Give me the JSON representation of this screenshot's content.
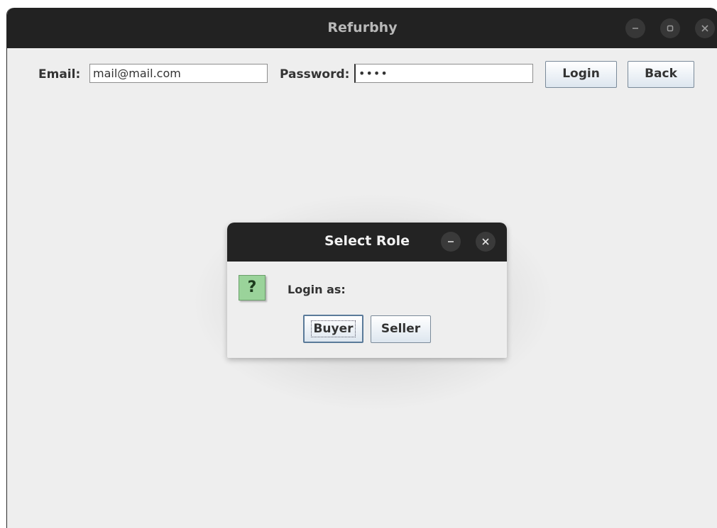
{
  "window": {
    "title": "Refurbhy",
    "minimize_symbol": "–",
    "close_symbol": "×"
  },
  "form": {
    "email_label": "Email:",
    "email_value": "mail@mail.com",
    "password_label": "Password:",
    "password_value": "••••",
    "login_label": "Login",
    "back_label": "Back"
  },
  "dialog": {
    "title": "Select Role",
    "minimize_symbol": "–",
    "close_symbol": "×",
    "icon_glyph": "?",
    "message": "Login as:",
    "buyer_label": "Buyer",
    "seller_label": "Seller"
  },
  "icons": {
    "window_minimize": "minimize-icon",
    "window_maximize": "maximize-icon",
    "window_close": "close-icon",
    "question": "question-icon"
  },
  "colors": {
    "titlebar": "#222222",
    "window_bg": "#eeeeee",
    "question_icon_bg": "#9ad39a",
    "button_gradient_bottom": "#dde6ef"
  }
}
